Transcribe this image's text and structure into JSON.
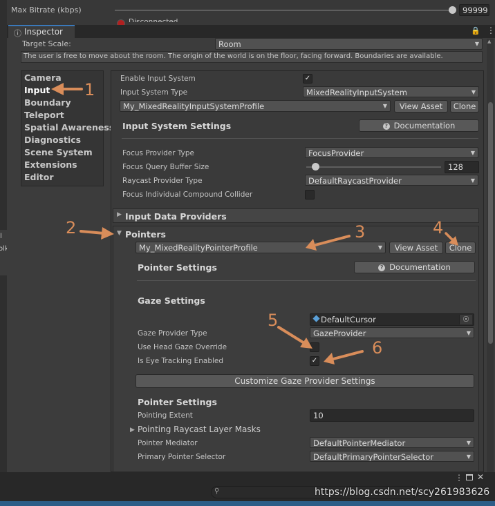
{
  "top": {
    "max_bitrate_label": "Max Bitrate (kbps)",
    "max_bitrate_value": "99999",
    "connection_status_value": "Disconnected",
    "slider_fraction": 1.0
  },
  "inspector": {
    "tab_label": "Inspector",
    "target_scale_label": "Target Scale:",
    "target_scale_value": "Room",
    "info_text": "The user is free to move about the room. The origin of the world is on the floor, facing forward. Boundaries are available."
  },
  "nav": {
    "items": [
      "Camera",
      "Input",
      "Boundary",
      "Teleport",
      "Spatial Awareness",
      "Diagnostics",
      "Scene System",
      "Extensions",
      "Editor"
    ]
  },
  "input_system": {
    "enable_label": "Enable Input System",
    "enable_checked": true,
    "type_label": "Input System Type",
    "type_value": "MixedRealityInputSystem",
    "profile_value": "My_MixedRealityInputSystemProfile",
    "view_asset": "View Asset",
    "clone": "Clone",
    "settings_header": "Input System Settings",
    "documentation": "Documentation",
    "focus_provider_label": "Focus Provider Type",
    "focus_provider_value": "FocusProvider",
    "focus_buffer_label": "Focus Query Buffer Size",
    "focus_buffer_value": "128",
    "focus_buffer_fraction": 0.06,
    "raycast_label": "Raycast Provider Type",
    "raycast_value": "DefaultRaycastProvider",
    "compound_label": "Focus Individual Compound Collider",
    "compound_checked": false
  },
  "sections": {
    "input_data_providers": "Input Data Providers",
    "pointers": "Pointers"
  },
  "pointers": {
    "profile_value": "My_MixedRealityPointerProfile",
    "view_asset": "View Asset",
    "clone": "Clone",
    "settings_header": "Pointer Settings",
    "documentation": "Documentation",
    "gaze_header": "Gaze Settings",
    "cursor_value": "DefaultCursor",
    "gaze_provider_label": "Gaze Provider Type",
    "gaze_provider_value": "GazeProvider",
    "head_gaze_label": "Use Head Gaze Override",
    "head_gaze_checked": false,
    "eye_tracking_label": "Is Eye Tracking Enabled",
    "eye_tracking_checked": true,
    "customize_button": "Customize Gaze Provider Settings",
    "pointer_settings_header": "Pointer Settings",
    "pointing_extent_label": "Pointing Extent",
    "pointing_extent_value": "10",
    "raycast_masks_label": "Pointing Raycast Layer Masks",
    "mediator_label": "Pointer Mediator",
    "mediator_value": "DefaultPointerMediator",
    "primary_selector_label": "Primary Pointer Selector",
    "primary_selector_value": "DefaultPrimaryPointerSelector"
  },
  "left_strip": {
    "text1": "l",
    "text2": "olk"
  },
  "annotations": [
    "1",
    "2",
    "3",
    "4",
    "5",
    "6"
  ],
  "watermark": "https://blog.csdn.net/scy261983626",
  "colors": {
    "annotation": "#d98d5a",
    "panel_bg": "#3c3c3c",
    "field_bg": "#2a2a2a",
    "button_bg": "#585858"
  }
}
